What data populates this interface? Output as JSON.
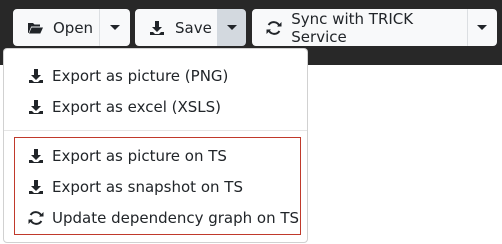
{
  "toolbar": {
    "open_label": "Open",
    "save_label": "Save",
    "sync_label": "Sync with TRICK Service"
  },
  "save_menu": {
    "items": [
      {
        "label": "Export as picture (PNG)",
        "icon": "download-icon"
      },
      {
        "label": "Export as excel (XSLS)",
        "icon": "download-icon"
      },
      {
        "label": "Export as picture on TS",
        "icon": "download-icon"
      },
      {
        "label": "Export as snapshot on TS",
        "icon": "download-icon"
      },
      {
        "label": "Update dependency graph on TS",
        "icon": "sync-icon"
      }
    ]
  },
  "colors": {
    "toolbar_bg": "#282828",
    "button_bg": "#f8f9fa",
    "highlight_border": "#c0392b"
  }
}
